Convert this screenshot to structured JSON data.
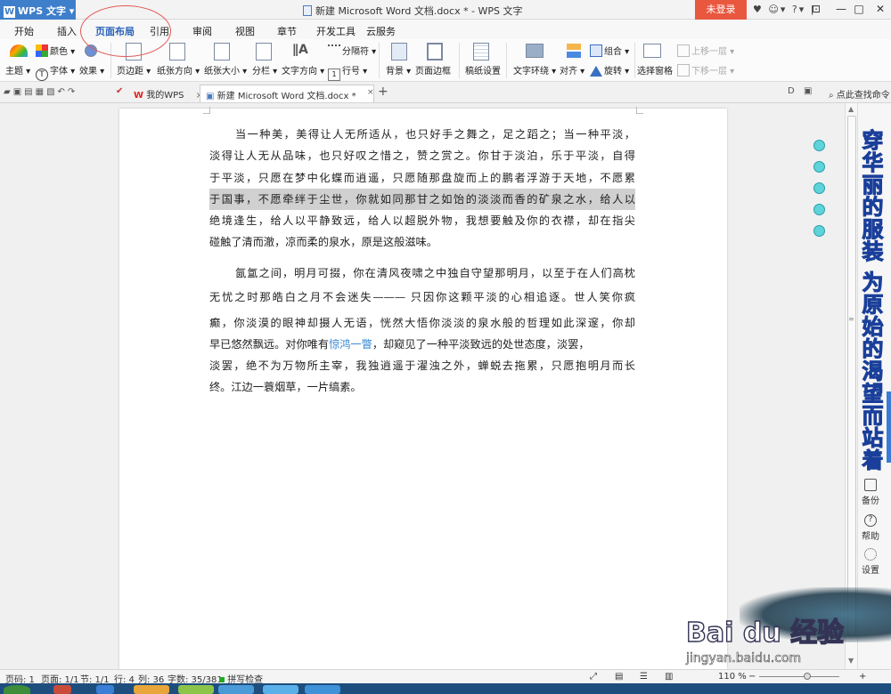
{
  "title_bar": {
    "app_name": "WPS 文字",
    "window_title": "新建 Microsoft Word 文档.docx * - WPS 文字",
    "login_label": "未登录",
    "icons": [
      "shirt-icon",
      "user-icon",
      "help-icon",
      "pin-icon",
      "restore-icon",
      "minimize-icon",
      "maximize-icon",
      "close-icon"
    ]
  },
  "menu_tabs": [
    "开始",
    "插入",
    "页面布局",
    "引用",
    "审阅",
    "视图",
    "章节",
    "开发工具",
    "云服务"
  ],
  "active_tab": "页面布局",
  "ribbon": {
    "theme": "主题",
    "colors": "颜色",
    "fonts": "字体",
    "effects": "效果",
    "margins": "页边距",
    "orientation": "纸张方向",
    "size": "纸张大小",
    "columns": "分栏",
    "text_direction": "文字方向",
    "breaks": "分隔符",
    "line_numbers": "行号",
    "background": "背景",
    "page_border": "页面边框",
    "draft_settings": "稿纸设置",
    "text_wrap": "文字环绕",
    "align": "对齐",
    "group": "组合",
    "rotate": "旋转",
    "selection_pane": "选择窗格",
    "bring_forward": "上移一层",
    "send_backward": "下移一层"
  },
  "doc_tabs": {
    "home_tab": "我的WPS",
    "doc_tab": "新建 Microsoft Word 文档.docx *",
    "search_label": "点此查找命令"
  },
  "document": {
    "paragraph1": [
      "当一种美，美得让人无所适从，也只好手之舞之，足之蹈之；当一种平淡，",
      "淡得让人无从品味，也只好叹之惜之，赞之赏之。你甘于淡泊，乐于平淡，自得",
      "于平淡，只愿在梦中化蝶而逍遥，只愿随那盘旋而上的鹏者浮游于天地，不愿累",
      "于国事，不愿牵绊于尘世，你就如同那甘之如饴的淡淡而香的矿泉之水，给人以",
      "绝境逢生，给人以平静致远，给人以超脱外物，我想要触及你的衣襟，却在指尖",
      "碰触了清而澈，凉而柔的泉水，原是这般滋味。"
    ],
    "paragraph2": [
      "氤氲之间，明月可掇，你在清风夜啸之中独自守望那明月，以至于在人们高枕",
      "无忧之时那皓白之月不会迷失———  只因你这颗平淡的心相追逐。世人笑你疯",
      "癫，你淡漠的眼神却摄人无语，恍然大悟你淡淡的泉水般的哲理如此深邃，你却",
      "早已悠然飘远。对你唯有",
      "惊鸿一瞥",
      "，却窥见了一种平淡致远的处世态度，淡罢，",
      "淡罢，绝不为万物所主宰，我独逍遥于濯浊之外，蝉蜕去拖累，只愿抱明月而长",
      "终。江边一蓑烟草，一片缟素。"
    ]
  },
  "side_banner": "穿华丽的服装 为原始的渴望而站着",
  "right_panel": [
    {
      "label": "备份",
      "icon": "backup-icon"
    },
    {
      "label": "帮助",
      "icon": "help-icon"
    },
    {
      "label": "设置",
      "icon": "settings-icon"
    }
  ],
  "watermark": {
    "brand": "Bai du 经验",
    "url": "jingyan.baidu.com"
  },
  "status_bar": {
    "page_num": "页码: 1",
    "pages": "页面: 1/1",
    "section": "节: 1/1",
    "row": "行: 4",
    "col": "列: 36",
    "word_count": "字数: 35/381",
    "spell_check": "拼写检查",
    "zoom": "110 %"
  },
  "colors": {
    "accent_blue": "#3e7fcb",
    "login_red": "#e9573f",
    "annotation_circle": "#e05a55",
    "bubble_cyan": "#5fd3da",
    "link_blue": "#3c8bd6"
  }
}
